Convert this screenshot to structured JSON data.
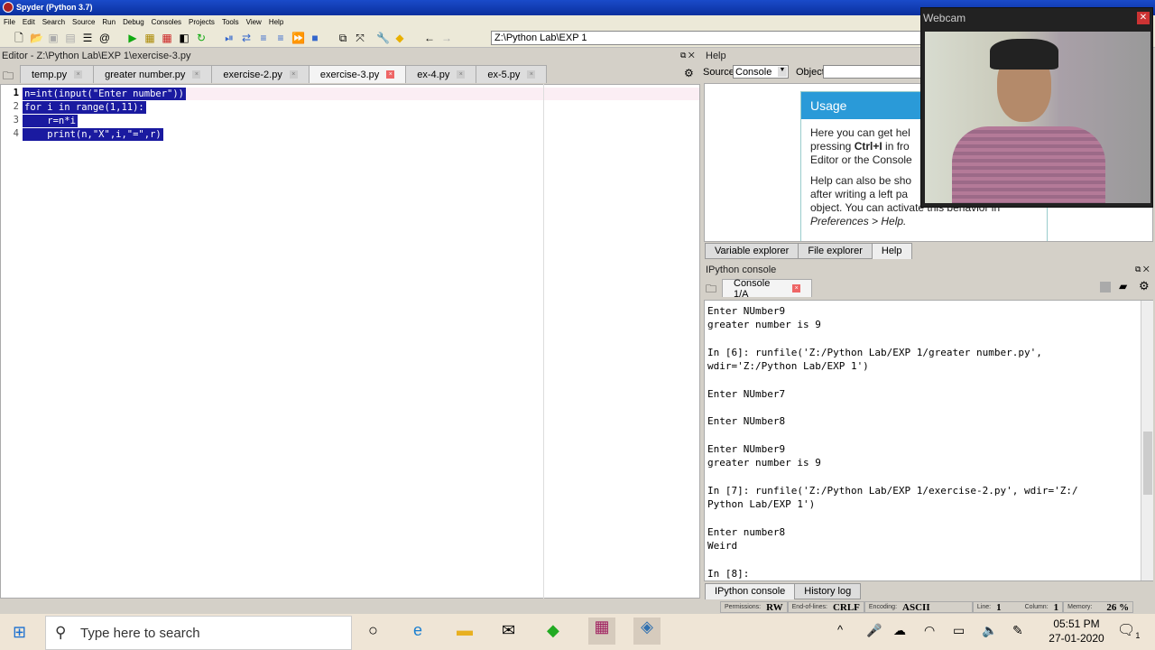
{
  "window": {
    "title": "Spyder (Python 3.7)"
  },
  "menu": [
    "File",
    "Edit",
    "Search",
    "Source",
    "Run",
    "Debug",
    "Consoles",
    "Projects",
    "Tools",
    "View",
    "Help"
  ],
  "toolbar": {
    "path": "Z:\\Python Lab\\EXP 1"
  },
  "editor": {
    "title": "Editor - Z:\\Python Lab\\EXP 1\\exercise-3.py",
    "tabs": [
      {
        "label": "temp.py"
      },
      {
        "label": "greater number.py"
      },
      {
        "label": "exercise-2.py"
      },
      {
        "label": "exercise-3.py",
        "active": true
      },
      {
        "label": "ex-4.py"
      },
      {
        "label": "ex-5.py"
      }
    ],
    "lines": [
      "n=int(input(\"Enter number\"))",
      "for i in range(1,11):",
      "    r=n*i",
      "    print(n,\"X\",i,\"=\",r)"
    ]
  },
  "help": {
    "title": "Help",
    "source_label": "Source",
    "source_value": "Console",
    "object_label": "Object",
    "usage_title": "Usage",
    "p1a": "Here you can get hel",
    "p1b": "pressing ",
    "p1bold": "Ctrl+I",
    "p1c": " in fro",
    "p1d": "Editor or the Console",
    "p2a": "Help can also be sho",
    "p2b": "after writing a left pa",
    "p2c": "object. You can activate this behavior in",
    "p2d": "Preferences > Help."
  },
  "right_tabs": [
    "Variable explorer",
    "File explorer",
    "Help"
  ],
  "console": {
    "title": "IPython console",
    "tab": "Console 1/A",
    "output": "Enter NUmber9\ngreater number is 9\n\nIn [6]: runfile('Z:/Python Lab/EXP 1/greater number.py',\nwdir='Z:/Python Lab/EXP 1')\n\nEnter NUmber7\n\nEnter NUmber8\n\nEnter NUmber9\ngreater number is 9\n\nIn [7]: runfile('Z:/Python Lab/EXP 1/exercise-2.py', wdir='Z:/\nPython Lab/EXP 1')\n\nEnter number8\nWeird\n\nIn [8]: "
  },
  "bottom_tabs": [
    "IPython console",
    "History log"
  ],
  "status": {
    "permissions_label": "Permissions:",
    "permissions": "RW",
    "eol_label": "End-of-lines:",
    "eol": "CRLF",
    "encoding_label": "Encoding:",
    "encoding": "ASCII",
    "line_label": "Line:",
    "line": "1",
    "column_label": "Column:",
    "column": "1",
    "memory_label": "Memory:",
    "memory": "26 %"
  },
  "taskbar": {
    "search_placeholder": "Type here to search",
    "time": "05:51 PM",
    "date": "27-01-2020",
    "notifications": "1"
  },
  "webcam": {
    "title": "Webcam"
  }
}
